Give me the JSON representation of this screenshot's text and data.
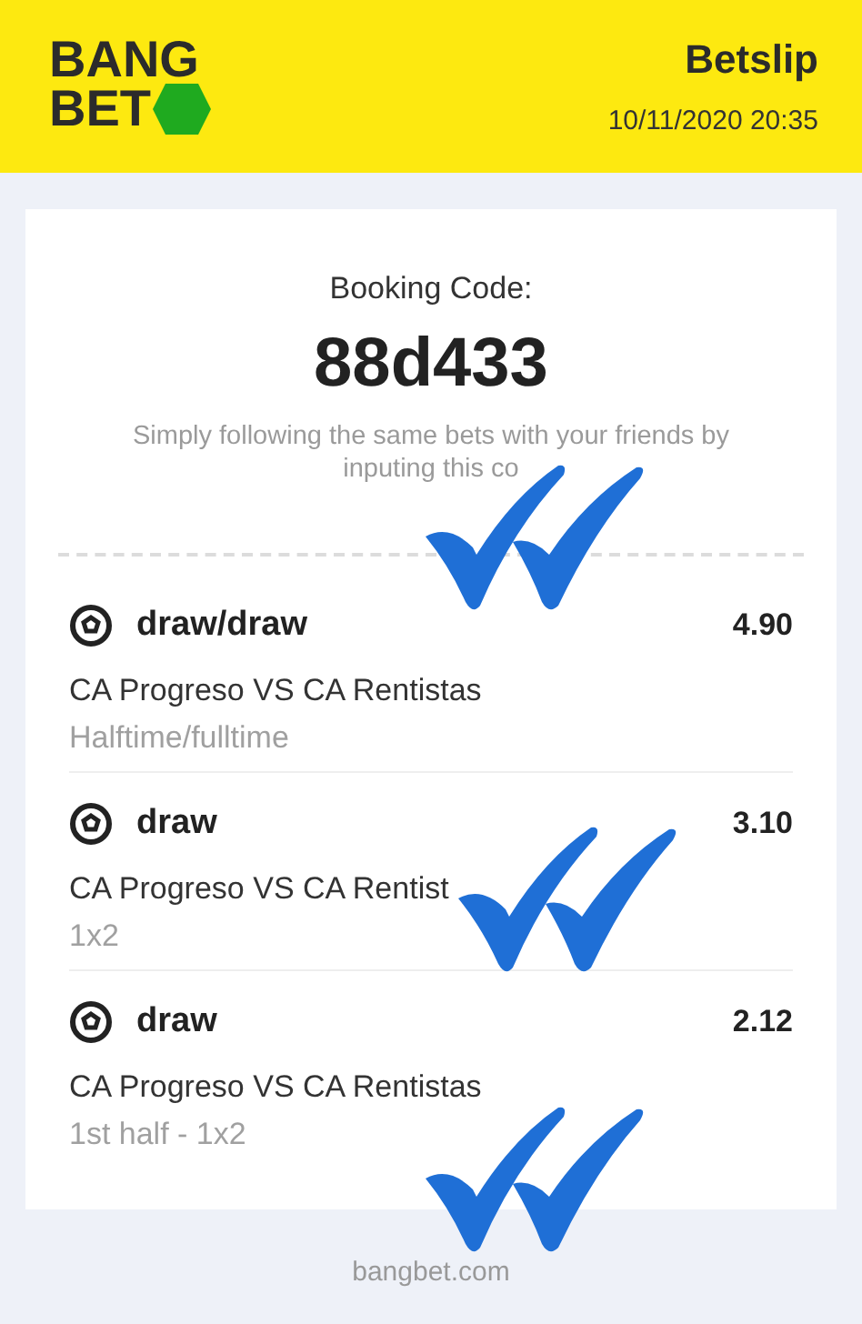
{
  "header": {
    "logo": [
      "BANG",
      "BET"
    ],
    "title": "Betslip",
    "datetime": "10/11/2020 20:35"
  },
  "booking": {
    "label": "Booking Code:",
    "code": "88d433",
    "hint_lines": [
      "Simply following the same bets with your friends by",
      "inputing this co"
    ]
  },
  "bets": [
    {
      "pick": "draw/draw",
      "odds": "4.90",
      "match": "CA Progreso VS  CA Rentistas",
      "market": "Halftime/fulltime"
    },
    {
      "pick": "draw",
      "odds": "3.10",
      "match": "CA Progreso VS  CA Rentist",
      "market": "1x2"
    },
    {
      "pick": "draw",
      "odds": "2.12",
      "match": "CA Progreso VS  CA Rentistas",
      "market": "1st half - 1x2"
    }
  ],
  "footer": "bangbet.com"
}
